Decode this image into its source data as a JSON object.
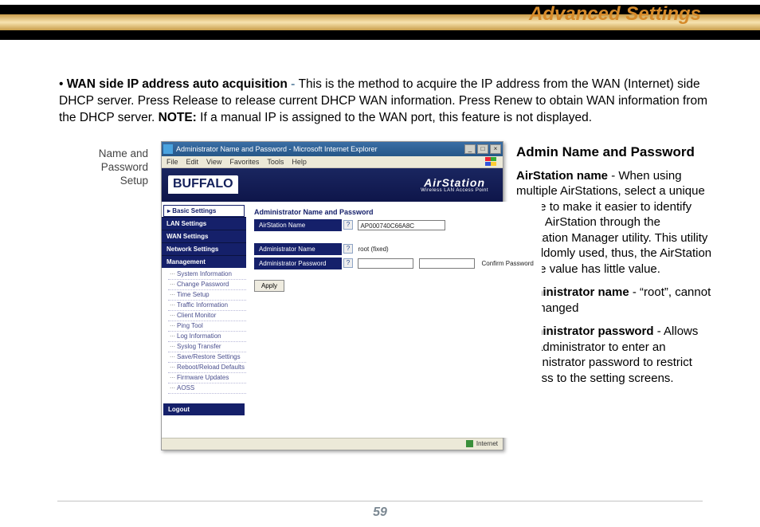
{
  "header": {
    "title": "Advanced Settings"
  },
  "intro": {
    "bullet": "•",
    "lead": "WAN side IP address auto acquisition",
    "dash": " - ",
    "body1": "This is the method to acquire the IP address from the WAN (Internet) side DHCP server.   Press Release to release current DHCP WAN information.  Press Renew to obtain WAN information from the DHCP server.  ",
    "note_label": "NOTE:",
    "body2": "  If a manual IP is assigned to the WAN port, this feature is not displayed."
  },
  "side_label": {
    "l1": "Name and",
    "l2": "Password",
    "l3": "Setup"
  },
  "screenshot": {
    "titlebar": "Administrator Name and Password - Microsoft Internet Explorer",
    "menubar": [
      "File",
      "Edit",
      "View",
      "Favorites",
      "Tools",
      "Help"
    ],
    "brand": "BUFFALO",
    "airstation_top": "AirStation",
    "airstation_sub": "Wireless LAN Access Point",
    "sidebar": {
      "basic": "▸ Basic Settings",
      "sections": [
        "LAN Settings",
        "WAN Settings",
        "Network Settings",
        "Management"
      ],
      "tree": [
        "System Information",
        "Change Password",
        "Time Setup",
        "Traffic Information",
        "Client Monitor",
        "Ping Tool",
        "Log Information",
        "Syslog Transfer",
        "Save/Restore Settings",
        "Reboot/Reload Defaults",
        "Firmware Updates",
        "AOSS"
      ],
      "logout": "Logout"
    },
    "main": {
      "section_title": "Administrator Name and Password",
      "row1_label": "AirStation Name",
      "row1_value": "AP000740C66A8C",
      "row2_label": "Administrator Name",
      "row2_value": "root (fixed)",
      "row3_label": "Administrator Password",
      "confirm": "Confirm Password",
      "apply": "Apply"
    },
    "statusbar": "Internet"
  },
  "right": {
    "heading": "Admin Name and Password",
    "p1_bold": "AirStation name",
    "p1_body": " - When using multiple AirStations, select a unique name to make it easier to identify each AirStation through the AirStation Manager utility. This utility is seldomly used, thus, the AirStation name value has little value.",
    "p2_bold": "Administrator name",
    "p2_body": " - “root”, cannot be changed",
    "p3_bold": "Administrator password",
    "p3_body": " - Allows the administrator to enter an administrator password to restrict access to the setting screens."
  },
  "pagenum": "59"
}
